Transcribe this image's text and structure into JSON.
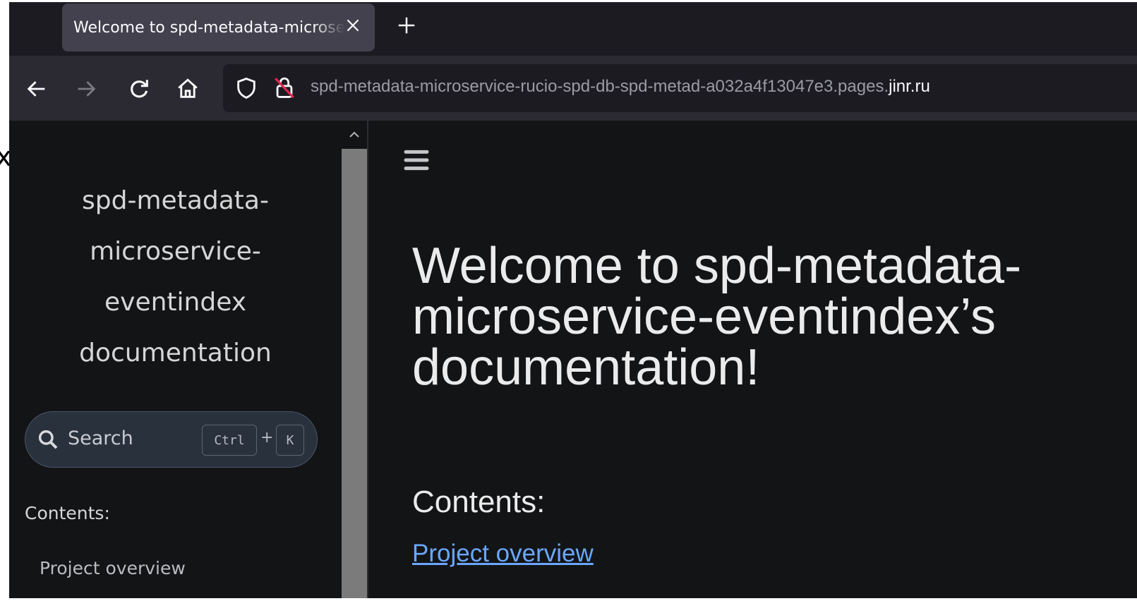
{
  "edge": {
    "char": "x"
  },
  "browser": {
    "tab": {
      "title": "Welcome to spd-metadata-microservice-eventindex's documentation!"
    },
    "url": {
      "prefix": "spd-metadata-microservice-rucio-spd-db-spd-metad-a032a4f13047e3.pages.",
      "domain": "jinr.ru"
    },
    "icons": [
      "back-icon",
      "forward-icon",
      "reload-icon",
      "home-icon",
      "shield-icon",
      "insecure-lock-icon",
      "close-icon",
      "plus-icon"
    ]
  },
  "sidebar": {
    "title": "spd-metadata-microservice-eventindex documentation",
    "search": {
      "placeholder": "Search",
      "key1": "Ctrl",
      "plus": "+",
      "key2": "K"
    },
    "caption": "Contents:",
    "items": [
      {
        "label": "Project overview"
      }
    ]
  },
  "main": {
    "heading": "Welcome to spd-metadata-microservice-eventindex’s documentation!",
    "subheading": "Contents:",
    "links": [
      {
        "label": "Project overview"
      }
    ]
  },
  "colors": {
    "link": "#6aa7ff",
    "page_bg": "#131416",
    "sidebar_search_bg": "#29313d"
  }
}
